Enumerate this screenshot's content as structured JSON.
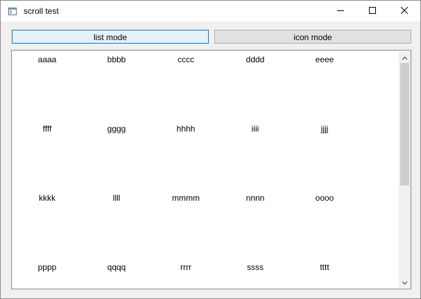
{
  "window": {
    "title": "scroll test",
    "icon": "app-window-icon",
    "controls": [
      "minimize-icon",
      "maximize-icon",
      "close-icon"
    ]
  },
  "toolbar": {
    "list_mode_label": "list mode",
    "icon_mode_label": "icon mode"
  },
  "view": {
    "items": [
      "aaaa",
      "bbbb",
      "cccc",
      "dddd",
      "eeee",
      "ffff",
      "gggg",
      "hhhh",
      "iiii",
      "jjjj",
      "kkkk",
      "llll",
      "mmmm",
      "nnnn",
      "oooo",
      "pppp",
      "qqqq",
      "rrrr",
      "ssss",
      "tttt"
    ],
    "scroll_position_fraction": 0.0
  },
  "colors": {
    "selected_button_border": "#0078d7",
    "selected_button_bg": "#e5f1fb",
    "button_bg": "#e1e1e1",
    "scroll_thumb": "#cdcdcd"
  }
}
